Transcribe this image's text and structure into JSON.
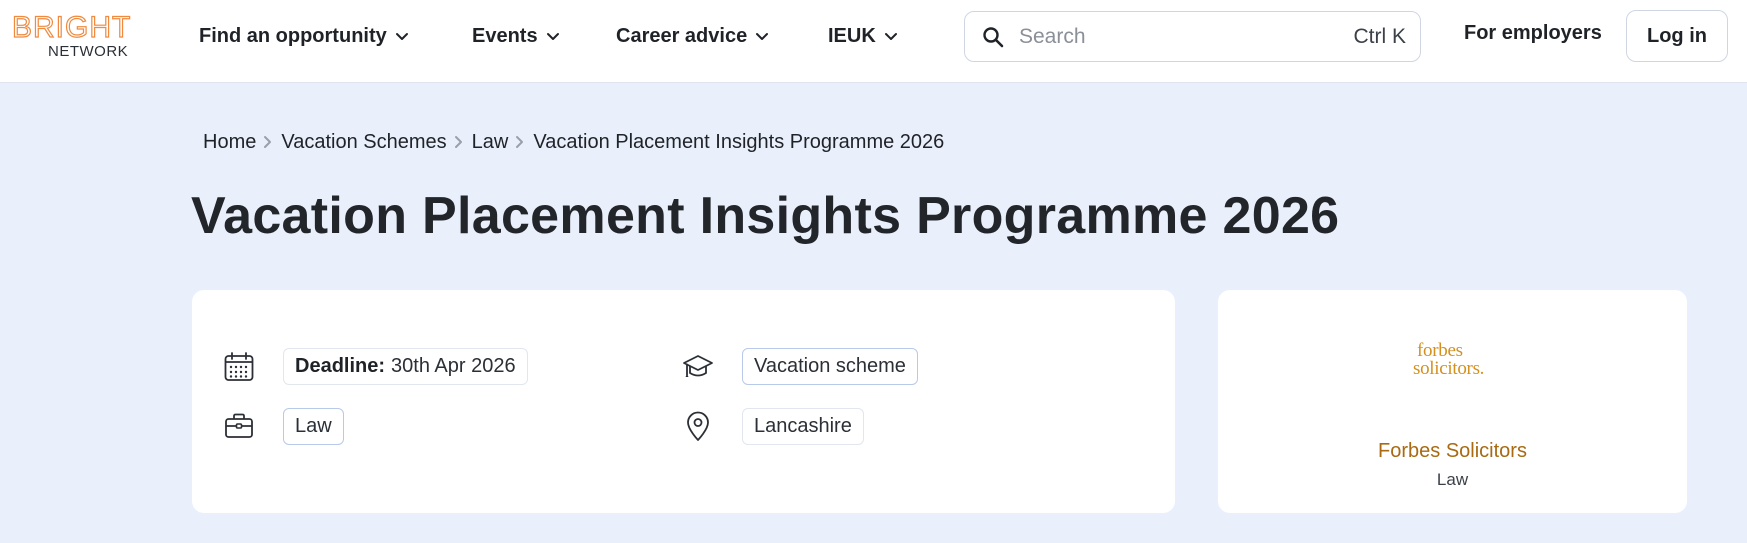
{
  "header": {
    "logo_top": "BRIGHT",
    "logo_bottom": "NETWORK",
    "nav": [
      {
        "label": "Find an opportunity"
      },
      {
        "label": "Events"
      },
      {
        "label": "Career advice"
      },
      {
        "label": "IEUK"
      }
    ],
    "search": {
      "placeholder": "Search",
      "shortcut": "Ctrl K"
    },
    "for_employers": "For employers",
    "login": "Log in"
  },
  "breadcrumb": [
    "Home",
    "Vacation Schemes",
    "Law",
    "Vacation Placement Insights Programme 2026"
  ],
  "title": "Vacation Placement Insights Programme 2026",
  "details": {
    "deadline_label": "Deadline:",
    "deadline_value": "30th Apr 2026",
    "type": "Vacation scheme",
    "sector": "Law",
    "location": "Lancashire"
  },
  "company": {
    "logo_line1": "forbes",
    "logo_line2": "solicitors.",
    "name": "Forbes Solicitors",
    "sector": "Law"
  },
  "colors": {
    "brand_orange": "#f08a3e",
    "page_bg": "#eaf0fb",
    "company_gold": "#a86a12"
  }
}
